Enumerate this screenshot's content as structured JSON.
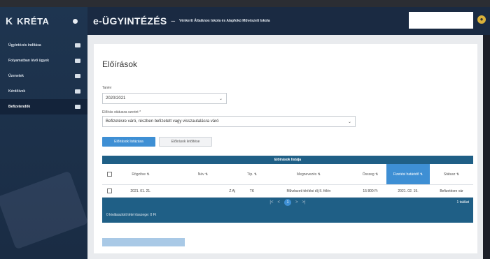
{
  "app": {
    "logo_mark": "K",
    "logo_text": "KRÉTA",
    "title": "e-ÜGYINTÉZÉS",
    "separator": "–",
    "school": "Vénkerti Általános Iskola és Alapfokú Művészeti Iskola"
  },
  "sidebar": {
    "items": [
      {
        "label": "Ügyintézés indítása",
        "icon": "edit-icon"
      },
      {
        "label": "Folyamatban lévő ügyek",
        "icon": "folder-icon"
      },
      {
        "label": "Üzenetek",
        "icon": "mail-icon"
      },
      {
        "label": "Kérdőívek",
        "icon": "list-icon"
      },
      {
        "label": "Befizetendők",
        "icon": "person-icon"
      }
    ]
  },
  "page": {
    "title": "Előírások",
    "tanev_label": "Tanév",
    "tanev_value": "2020/2021",
    "status_label": "Előírás státusza szerint *",
    "status_value": "Befizetésre váró, részben befizetett vagy visszautalásra váró",
    "search_button": "Előírások listázása",
    "download_button": "Előírások letöltése"
  },
  "table": {
    "title": "Előírások listája",
    "columns": [
      "Rögzítve ⇅",
      "Név ⇅",
      "Típ. ⇅",
      "Megnevezés ⇅",
      "Összeg ⇅",
      "Fizetési határidő ⇅",
      "Státusz ⇅"
    ],
    "rows": [
      {
        "rogzitve": "2021. 01. 21.",
        "nev_suffix": "Z Aj",
        "tip": "TK",
        "megnevezes": "Művészeti térítési díj II. félév",
        "osszeg": "15 800 Ft",
        "hatarido": "2021. 02. 19.",
        "statusz": "Befizetésre vár"
      }
    ],
    "pager": {
      "first": "|<",
      "prev": "<",
      "current": "1",
      "next": ">",
      "last": ">|",
      "count": "1 találat"
    },
    "summary": "0 kiválasztott tétel összege: 0 Ft"
  },
  "colors": {
    "accent": "#3e8fd4",
    "table_header": "#1f5f86",
    "sidebar": "#1e3550"
  }
}
